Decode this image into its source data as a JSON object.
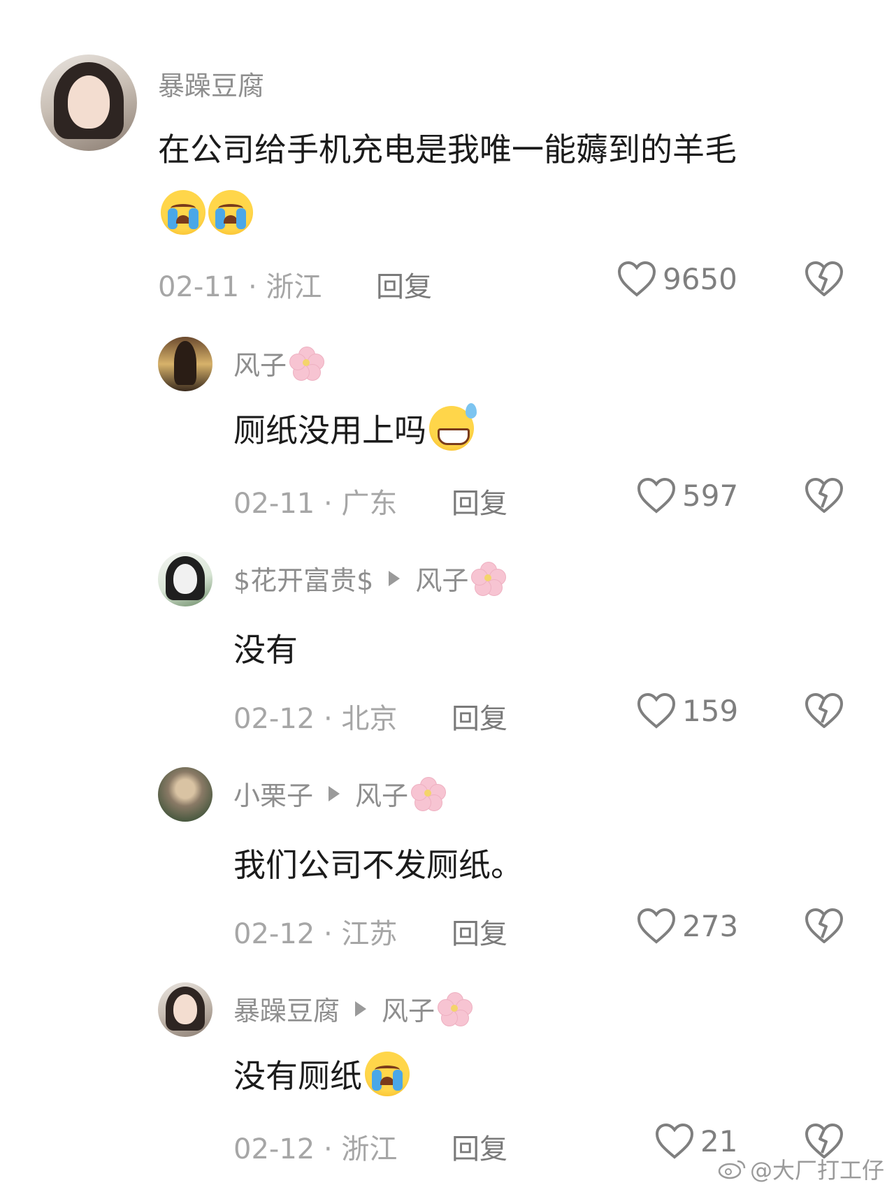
{
  "comments": [
    {
      "author": "暴躁豆腐",
      "reply_to": "",
      "text": "在公司给手机充电是我唯一能薅到的羊毛",
      "date_location": "02-11 · 浙江",
      "reply_label": "回复",
      "likes": "9650",
      "emoji": [
        "loudly-crying-face",
        "loudly-crying-face"
      ]
    },
    {
      "author": "风子",
      "reply_to": "",
      "text": "厕纸没用上吗",
      "date_location": "02-11 · 广东",
      "reply_label": "回复",
      "likes": "597",
      "emoji": [
        "grinning-face-with-sweat"
      ]
    },
    {
      "author": "$花开富贵$",
      "reply_to": "风子",
      "text": "没有",
      "date_location": "02-12 · 北京",
      "reply_label": "回复",
      "likes": "159",
      "emoji": []
    },
    {
      "author": "小栗子",
      "reply_to": "风子",
      "text": "我们公司不发厕纸。",
      "date_location": "02-12 · 江苏",
      "reply_label": "回复",
      "likes": "273",
      "emoji": []
    },
    {
      "author": "暴躁豆腐",
      "reply_to": "风子",
      "text": "没有厕纸",
      "date_location": "02-12 · 浙江",
      "reply_label": "回复",
      "likes": "21",
      "emoji": [
        "loudly-crying-face"
      ]
    }
  ],
  "watermark": "@大厂打工仔",
  "icons": {
    "like": "heart-outline-icon",
    "dislike": "broken-heart-icon",
    "name_badge": "cherry-blossom-icon"
  },
  "colors": {
    "name": "#8e8e8e",
    "text": "#1b1b1b",
    "meta": "#a6a6a6",
    "icon": "#7f7f7f"
  }
}
